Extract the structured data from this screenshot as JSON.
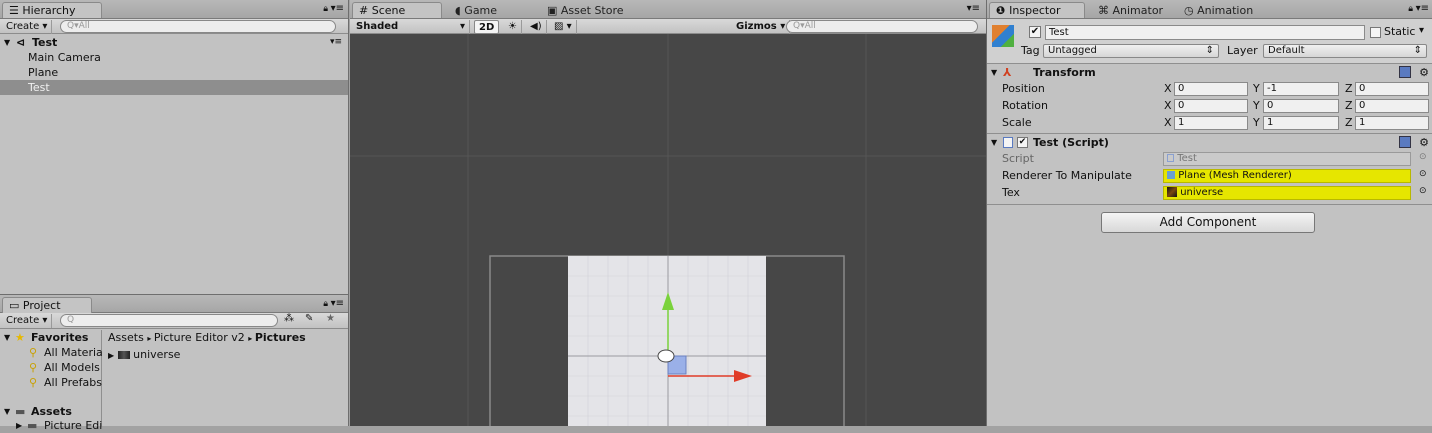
{
  "hierarchy": {
    "tab_label": "Hierarchy",
    "create_label": "Create",
    "search_placeholder": "Q▾All",
    "scene_name": "Test",
    "items": [
      "Main Camera",
      "Plane",
      "Test"
    ],
    "selected_item": "Test"
  },
  "scene_view": {
    "tabs": [
      "Scene",
      "Game",
      "Asset Store"
    ],
    "active_tab": "Scene",
    "shading_mode": "Shaded",
    "mode_2d_label": "2D",
    "gizmos_label": "Gizmos",
    "search_placeholder": "Q▾All",
    "colors": {
      "background": "#474747",
      "plane": "#dcdcdc",
      "x_axis": "#e03c28",
      "y_axis": "#7ad23c"
    }
  },
  "project": {
    "tab_label": "Project",
    "create_label": "Create",
    "favorites_label": "Favorites",
    "favorites": [
      "All Materia",
      "All Models",
      "All Prefabs"
    ],
    "assets_label": "Assets",
    "assets_children": [
      "Picture Edi"
    ],
    "breadcrumb": [
      "Assets",
      "Picture Editor v2",
      "Pictures"
    ],
    "files": [
      "universe"
    ]
  },
  "inspector": {
    "tabs": [
      "Inspector",
      "Animator",
      "Animation"
    ],
    "active_tab": "Inspector",
    "object_name": "Test",
    "static_label": "Static",
    "tag_label": "Tag",
    "tag_value": "Untagged",
    "layer_label": "Layer",
    "layer_value": "Default",
    "transform": {
      "title": "Transform",
      "rows": [
        {
          "label": "Position",
          "x": "0",
          "y": "-1",
          "z": "0"
        },
        {
          "label": "Rotation",
          "x": "0",
          "y": "0",
          "z": "0"
        },
        {
          "label": "Scale",
          "x": "1",
          "y": "1",
          "z": "1"
        }
      ],
      "axis_labels": [
        "X",
        "Y",
        "Z"
      ]
    },
    "script_component": {
      "title": "Test (Script)",
      "script_label": "Script",
      "script_value": "Test",
      "renderer_label": "Renderer To Manipulate",
      "renderer_value": "Plane (Mesh Renderer)",
      "tex_label": "Tex",
      "tex_value": "universe",
      "highlight_color": "#e6e600"
    },
    "add_component_label": "Add Component"
  }
}
